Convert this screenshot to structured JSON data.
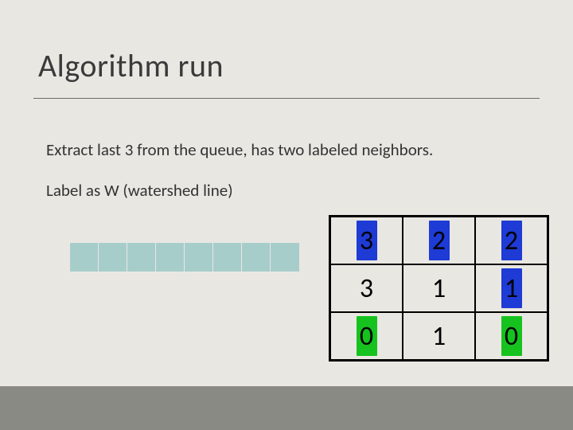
{
  "title": "Algorithm run",
  "body": {
    "line1": "Extract last 3 from the queue, has two labeled neighbors.",
    "line2": "Label as W (watershed line)"
  },
  "queue": {
    "cell_count": 8
  },
  "grid": {
    "rows": [
      [
        {
          "value": "3",
          "highlight": "blue"
        },
        {
          "value": "2",
          "highlight": "blue"
        },
        {
          "value": "2",
          "highlight": "blue"
        }
      ],
      [
        {
          "value": "3",
          "highlight": null
        },
        {
          "value": "1",
          "highlight": null
        },
        {
          "value": "1",
          "highlight": "blue"
        }
      ],
      [
        {
          "value": "0",
          "highlight": "green"
        },
        {
          "value": "1",
          "highlight": null
        },
        {
          "value": "0",
          "highlight": "green"
        }
      ]
    ]
  },
  "colors": {
    "highlight_blue": "#1e3bd6",
    "highlight_green": "#16c21e",
    "queue_cell": "#a7cdcb",
    "slide_bg": "#e9e7e2",
    "bottom_bar": "#8a8a84"
  }
}
